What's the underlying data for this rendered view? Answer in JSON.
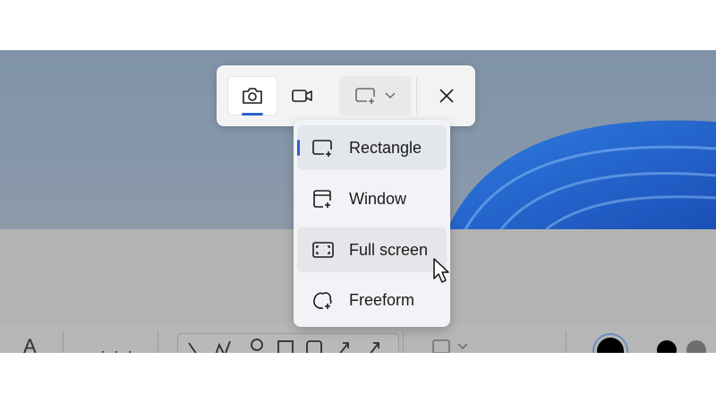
{
  "snip_toolbar": {
    "modes": [
      {
        "name": "camera-icon",
        "active": true
      },
      {
        "name": "video-camera-icon",
        "active": false
      }
    ],
    "shape_dropdown_icon": "rectangle-snip-icon",
    "close_icon": "close-icon"
  },
  "snip_menu": {
    "items": [
      {
        "label": "Rectangle",
        "icon": "rectangle-snip-icon",
        "selected": true
      },
      {
        "label": "Window",
        "icon": "window-snip-icon",
        "selected": false
      },
      {
        "label": "Full screen",
        "icon": "full-screen-snip-icon",
        "selected": false
      },
      {
        "label": "Freeform",
        "icon": "freeform-snip-icon",
        "selected": false
      }
    ]
  },
  "background_app": {
    "text_tool_label": "A",
    "colors": {
      "selected": "#000000",
      "swatch1": "#000000",
      "swatch2": "#6e6e6e"
    }
  },
  "theme": {
    "accent": "#2b63c7"
  }
}
